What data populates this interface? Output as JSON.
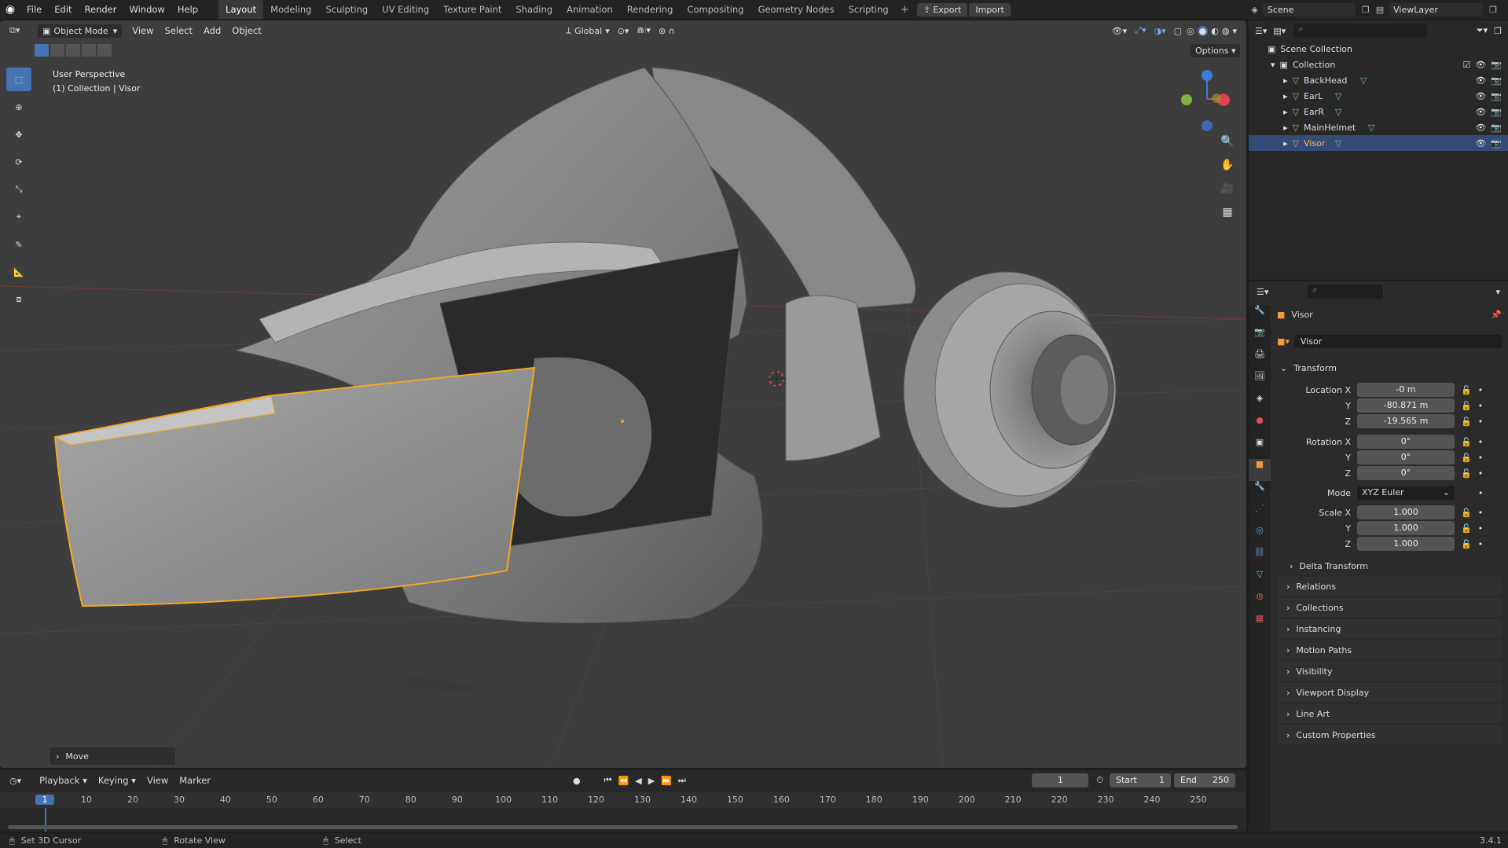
{
  "menubar": {
    "items": [
      "File",
      "Edit",
      "Render",
      "Window",
      "Help"
    ],
    "workspaces": [
      "Layout",
      "Modeling",
      "Sculpting",
      "UV Editing",
      "Texture Paint",
      "Shading",
      "Animation",
      "Rendering",
      "Compositing",
      "Geometry Nodes",
      "Scripting"
    ],
    "active_workspace": "Layout",
    "export_label": "Export",
    "import_label": "Import",
    "scene": "Scene",
    "view_layer": "ViewLayer"
  },
  "viewport": {
    "mode": "Object Mode",
    "menus": [
      "View",
      "Select",
      "Add",
      "Object"
    ],
    "orientation": "Global",
    "options_label": "Options",
    "perspective_label": "User Perspective",
    "collection_label": "(1) Collection | Visor",
    "operator_panel": "Move"
  },
  "outliner": {
    "scene_collection": "Scene Collection",
    "collection": "Collection",
    "objects": [
      "BackHead",
      "EarL",
      "EarR",
      "MainHelmet",
      "Visor"
    ],
    "selected": "Visor"
  },
  "properties": {
    "object_name": "Visor",
    "datablock_name": "Visor",
    "transform_label": "Transform",
    "location_label": "Location X",
    "location": [
      "-0 m",
      "-80.871 m",
      "-19.565 m"
    ],
    "rotation_label": "Rotation X",
    "rotation": [
      "0°",
      "0°",
      "0°"
    ],
    "mode_label": "Mode",
    "mode_value": "XYZ Euler",
    "scale_label": "Scale X",
    "scale": [
      "1.000",
      "1.000",
      "1.000"
    ],
    "axis_y": "Y",
    "axis_z": "Z",
    "delta_transform": "Delta Transform",
    "panels": [
      "Relations",
      "Collections",
      "Instancing",
      "Motion Paths",
      "Visibility",
      "Viewport Display",
      "Line Art",
      "Custom Properties"
    ]
  },
  "timeline": {
    "menus": [
      "Playback",
      "Keying",
      "View",
      "Marker"
    ],
    "current_frame": "1",
    "start_label": "Start",
    "start": "1",
    "end_label": "End",
    "end": "250",
    "ticks": [
      "1",
      "10",
      "20",
      "30",
      "40",
      "50",
      "60",
      "70",
      "80",
      "90",
      "100",
      "110",
      "120",
      "130",
      "140",
      "150",
      "160",
      "170",
      "180",
      "190",
      "200",
      "210",
      "220",
      "230",
      "240",
      "250"
    ]
  },
  "statusbar": {
    "set_cursor": "Set 3D Cursor",
    "rotate_view": "Rotate View",
    "select": "Select",
    "version": "3.4.1"
  },
  "colors": {
    "accent": "#4772b3",
    "selection_outline": "#f5a623",
    "viewport_bg": "#3d3d3d",
    "axis_x": "#e0414e",
    "axis_y": "#7bb53e",
    "axis_z": "#3c7be0"
  }
}
